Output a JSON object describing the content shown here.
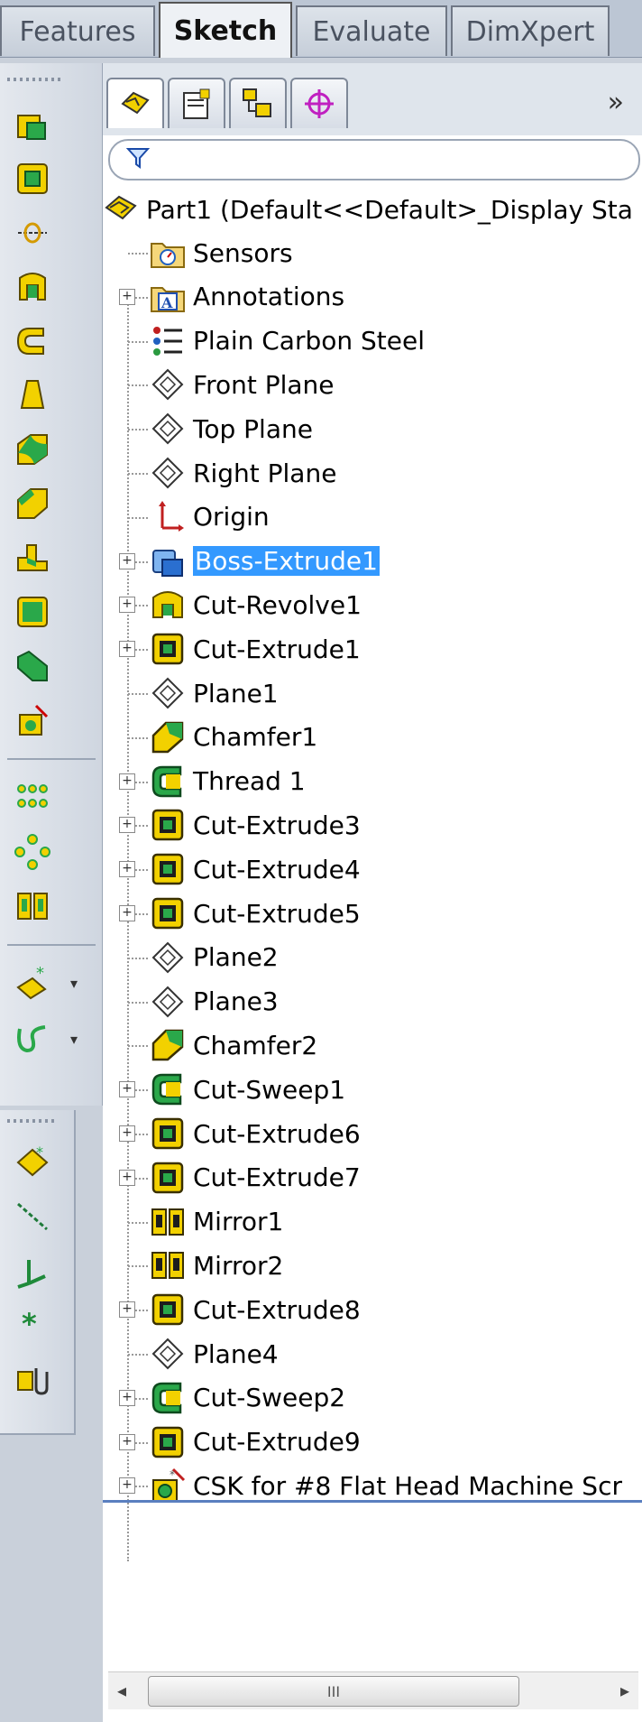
{
  "command_tabs": [
    "Features",
    "Sketch",
    "Evaluate",
    "DimXpert"
  ],
  "panel": {
    "more_label": "»"
  },
  "tree": {
    "root_label": "Part1  (Default<<Default>_Display Sta",
    "items": [
      {
        "label": "Sensors",
        "icon": "sensor-folder-icon",
        "expand": false
      },
      {
        "label": "Annotations",
        "icon": "annotations-icon",
        "expand": true
      },
      {
        "label": "Plain Carbon Steel",
        "icon": "material-icon",
        "expand": false
      },
      {
        "label": "Front Plane",
        "icon": "plane-icon",
        "expand": false
      },
      {
        "label": "Top Plane",
        "icon": "plane-icon",
        "expand": false
      },
      {
        "label": "Right Plane",
        "icon": "plane-icon",
        "expand": false
      },
      {
        "label": "Origin",
        "icon": "origin-icon",
        "expand": false
      },
      {
        "label": "Boss-Extrude1",
        "icon": "boss-extrude-icon",
        "expand": true,
        "selected": true
      },
      {
        "label": "Cut-Revolve1",
        "icon": "cut-revolve-icon",
        "expand": true
      },
      {
        "label": "Cut-Extrude1",
        "icon": "cut-extrude-icon",
        "expand": true
      },
      {
        "label": "Plane1",
        "icon": "plane-icon",
        "expand": false
      },
      {
        "label": "Chamfer1",
        "icon": "chamfer-icon",
        "expand": false
      },
      {
        "label": "Thread 1",
        "icon": "thread-icon",
        "expand": true
      },
      {
        "label": "Cut-Extrude3",
        "icon": "cut-extrude-icon",
        "expand": true
      },
      {
        "label": "Cut-Extrude4",
        "icon": "cut-extrude-icon",
        "expand": true
      },
      {
        "label": "Cut-Extrude5",
        "icon": "cut-extrude-icon",
        "expand": true
      },
      {
        "label": "Plane2",
        "icon": "plane-icon",
        "expand": false
      },
      {
        "label": "Plane3",
        "icon": "plane-icon",
        "expand": false
      },
      {
        "label": "Chamfer2",
        "icon": "chamfer-icon",
        "expand": false
      },
      {
        "label": "Cut-Sweep1",
        "icon": "cut-sweep-icon",
        "expand": true
      },
      {
        "label": "Cut-Extrude6",
        "icon": "cut-extrude-icon",
        "expand": true
      },
      {
        "label": "Cut-Extrude7",
        "icon": "cut-extrude-icon",
        "expand": true
      },
      {
        "label": "Mirror1",
        "icon": "mirror-icon",
        "expand": false
      },
      {
        "label": "Mirror2",
        "icon": "mirror-icon",
        "expand": false
      },
      {
        "label": "Cut-Extrude8",
        "icon": "cut-extrude-icon",
        "expand": true
      },
      {
        "label": "Plane4",
        "icon": "plane-icon",
        "expand": false
      },
      {
        "label": "Cut-Sweep2",
        "icon": "cut-sweep-icon",
        "expand": true
      },
      {
        "label": "Cut-Extrude9",
        "icon": "cut-extrude-icon",
        "expand": true
      },
      {
        "label": "CSK for #8 Flat Head Machine Scr",
        "icon": "hole-wizard-icon",
        "expand": true
      }
    ]
  },
  "scrollbar": {
    "grip_label": "III"
  },
  "colors": {
    "selection": "#3399ff",
    "feature_yellow": "#f2d100",
    "feature_green": "#2aa84a"
  }
}
